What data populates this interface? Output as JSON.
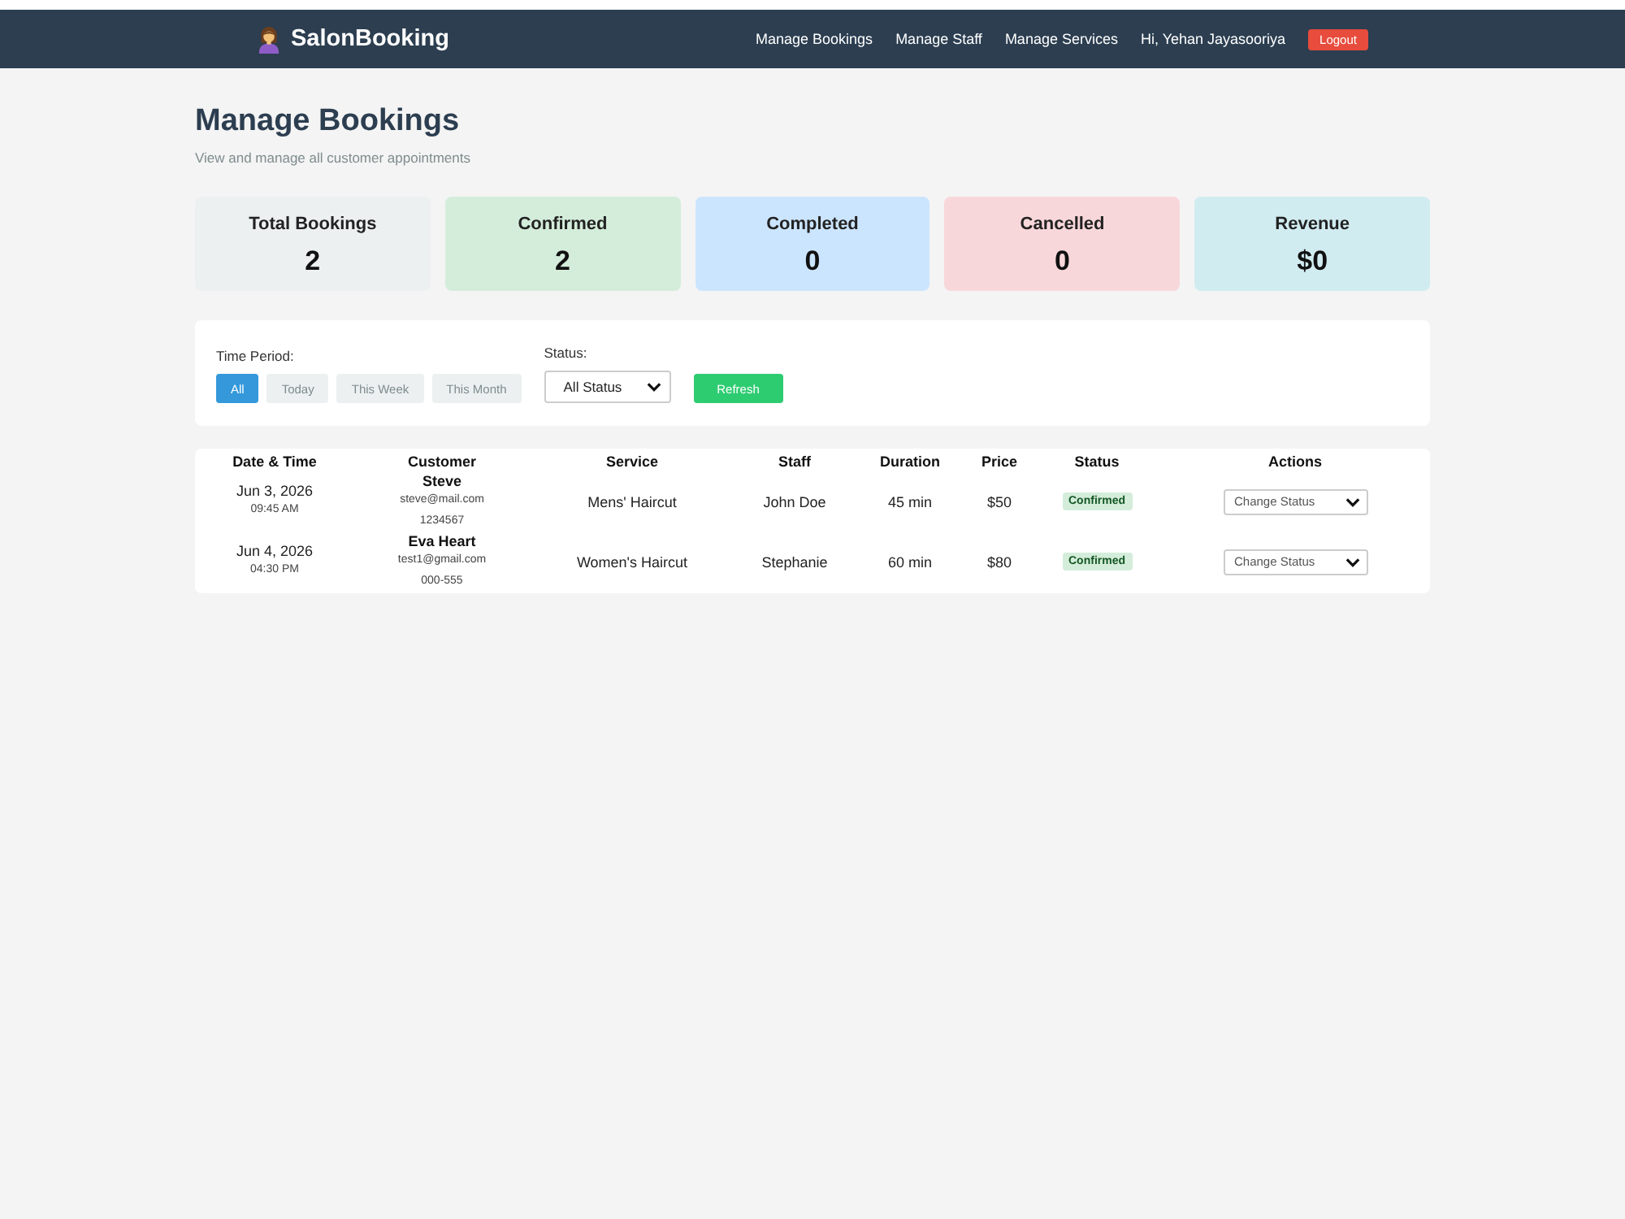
{
  "navbar": {
    "brand": "SalonBooking",
    "links": [
      "Manage Bookings",
      "Manage Staff",
      "Manage Services"
    ],
    "greeting": "Hi, Yehan Jayasooriya",
    "logout": "Logout"
  },
  "header": {
    "title": "Manage Bookings",
    "subtitle": "View and manage all customer appointments"
  },
  "stats": [
    {
      "label": "Total Bookings",
      "value": "2",
      "color": "#ecf0f1"
    },
    {
      "label": "Confirmed",
      "value": "2",
      "color": "#d4edda"
    },
    {
      "label": "Completed",
      "value": "0",
      "color": "#cce5ff"
    },
    {
      "label": "Cancelled",
      "value": "0",
      "color": "#f8d7da"
    },
    {
      "label": "Revenue",
      "value": "$0",
      "color": "#d1ecf1"
    }
  ],
  "filters": {
    "time_period": {
      "label": "Time Period:",
      "options": [
        {
          "label": "All",
          "selected": true
        },
        {
          "label": "Today",
          "selected": false
        },
        {
          "label": "This Week",
          "selected": false
        },
        {
          "label": "This Month",
          "selected": false
        }
      ]
    },
    "status": {
      "label": "Status:",
      "value": "All Status"
    },
    "refresh": "Refresh"
  },
  "table": {
    "columns": [
      "Date & Time",
      "Customer",
      "Service",
      "Staff",
      "Duration",
      "Price",
      "Status",
      "Actions"
    ],
    "rows": [
      {
        "date": "Jun 3, 2026",
        "time": "09:45 AM",
        "customer": {
          "name": "Steve",
          "email": "steve@mail.com",
          "phone": "1234567"
        },
        "service": "Mens' Haircut",
        "staff": "John Doe",
        "duration": "45 min",
        "price": "$50",
        "status": "Confirmed",
        "action": "Change Status"
      },
      {
        "date": "Jun 4, 2026",
        "time": "04:30 PM",
        "customer": {
          "name": "Eva Heart",
          "email": "test1@gmail.com",
          "phone": "000-555"
        },
        "service": "Women's Haircut",
        "staff": "Stephanie",
        "duration": "60 min",
        "price": "$80",
        "status": "Confirmed",
        "action": "Change Status"
      }
    ]
  }
}
